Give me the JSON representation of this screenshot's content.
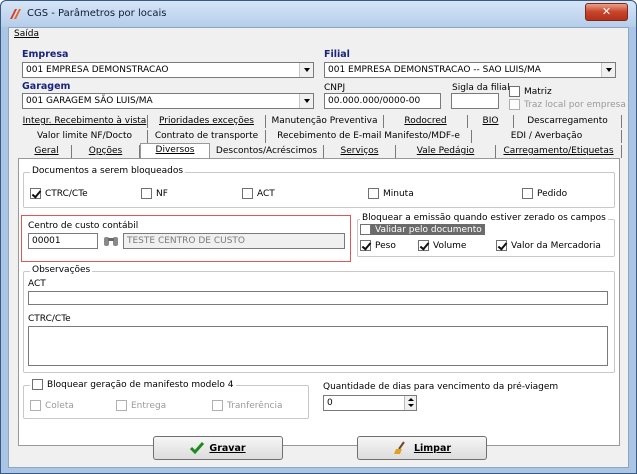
{
  "window": {
    "title": "CGS - Parâmetros por locais",
    "close_glyph": "✕"
  },
  "menu": {
    "saida": "Saída"
  },
  "empresa": {
    "label": "Empresa",
    "value": "001 EMPRESA DEMONSTRACAO"
  },
  "filial": {
    "label": "Filial",
    "value": "001 EMPRESA DEMONSTRACAO -- SAO LUIS/MA"
  },
  "garagem": {
    "label": "Garagem",
    "value": "001 GARAGEM SÃO LUIS/MA"
  },
  "cnpj": {
    "label": "CNPJ",
    "value": "00.000.000/0000-00"
  },
  "sigla": {
    "label": "Sigla da filial",
    "value": ""
  },
  "matriz": {
    "label": "Matriz",
    "checked": false
  },
  "traz_local": {
    "label": "Traz local por empresa",
    "checked": false
  },
  "tabs": {
    "row1": [
      "Integr. Recebimento à vista",
      "Prioridades exceções",
      "Manutenção Preventiva",
      "Rodocred",
      "BIO",
      "Descarregamento"
    ],
    "row2": [
      "Valor limite NF/Docto",
      "Contrato de transporte",
      "Recebimento de E-mail Manifesto/MDF-e",
      "EDI / Averbação"
    ],
    "row3": [
      "Geral",
      "Opções",
      "Diversos",
      "Descontos/Acréscimos",
      "Serviços",
      "Vale Pedágio",
      "Carregamento/Etiquetas"
    ]
  },
  "docs_bloqueados": {
    "title": "Documentos a serem bloqueados",
    "items": [
      {
        "label": "CTRC/CTe",
        "checked": true
      },
      {
        "label": "NF",
        "checked": false
      },
      {
        "label": "ACT",
        "checked": false
      },
      {
        "label": "Minuta",
        "checked": false
      },
      {
        "label": "Pedido",
        "checked": false
      }
    ]
  },
  "centro_custo": {
    "label": "Centro de custo contábil",
    "code": "00001",
    "description": "TESTE CENTRO DE CUSTO"
  },
  "bloquear_emissao": {
    "title": "Bloquear a emissão quando estiver zerado os campos",
    "validar": {
      "label": "Validar pelo documento",
      "checked": false
    },
    "peso": {
      "label": "Peso",
      "checked": true
    },
    "volume": {
      "label": "Volume",
      "checked": true
    },
    "valor_mercadoria": {
      "label": "Valor da Mercadoria",
      "checked": true
    }
  },
  "observacoes": {
    "title": "Observações",
    "act_label": "ACT",
    "act_value": "",
    "ctrc_label": "CTRC/CTe",
    "ctrc_value": ""
  },
  "manifesto": {
    "title": "Bloquear geração de manifesto modelo 4",
    "checked": false,
    "coleta": "Coleta",
    "entrega": "Entrega",
    "transferencia": "Tranferência"
  },
  "quantidade_dias": {
    "label": "Quantidade de dias para vencimento da pré-viagem",
    "value": "0"
  },
  "buttons": {
    "gravar": "Gravar",
    "limpar": "Limpar"
  }
}
